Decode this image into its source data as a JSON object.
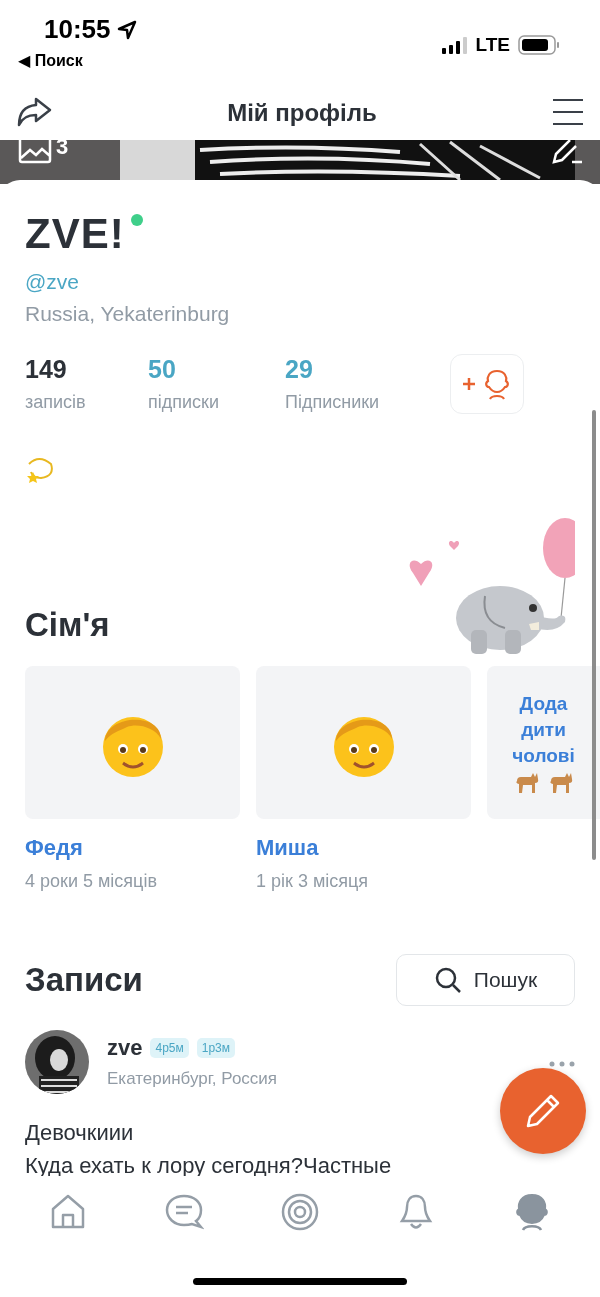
{
  "status_bar": {
    "time": "10:55",
    "back_link": "◀ Поиск",
    "network": "LTE"
  },
  "header": {
    "title": "Мій профіль"
  },
  "cover": {
    "photo_count": "3"
  },
  "profile": {
    "name": "ZVE!",
    "online": true,
    "handle": "@zve",
    "location": "Russia, Yekaterinburg",
    "stats": [
      {
        "value": "149",
        "label": "записів",
        "kind": "plain"
      },
      {
        "value": "50",
        "label": "підписки",
        "kind": "link"
      },
      {
        "value": "29",
        "label": "Підписники",
        "kind": "link"
      }
    ]
  },
  "family": {
    "title": "Сім'я",
    "members": [
      {
        "name": "Федя",
        "age": "4 роки 5 місяців"
      },
      {
        "name": "Миша",
        "age": "1 рік 3 місяця"
      }
    ],
    "add_card": {
      "lines": [
        "Дода",
        "дити",
        "чолові"
      ]
    }
  },
  "posts": {
    "title": "Записи",
    "search_button": "Пошук",
    "items": [
      {
        "author": "zve",
        "tags": [
          "4р5м",
          "1р3м"
        ],
        "location": "Екатеринбург, Россия",
        "text_lines": [
          "Девочкиии",
          "Куда ехать к лору сегодня?Частные"
        ]
      }
    ]
  },
  "nav": [
    {
      "kind": "home",
      "selected": false
    },
    {
      "kind": "chat",
      "selected": false
    },
    {
      "kind": "target",
      "selected": false
    },
    {
      "kind": "bell",
      "selected": false
    },
    {
      "kind": "profile",
      "selected": true
    }
  ]
}
